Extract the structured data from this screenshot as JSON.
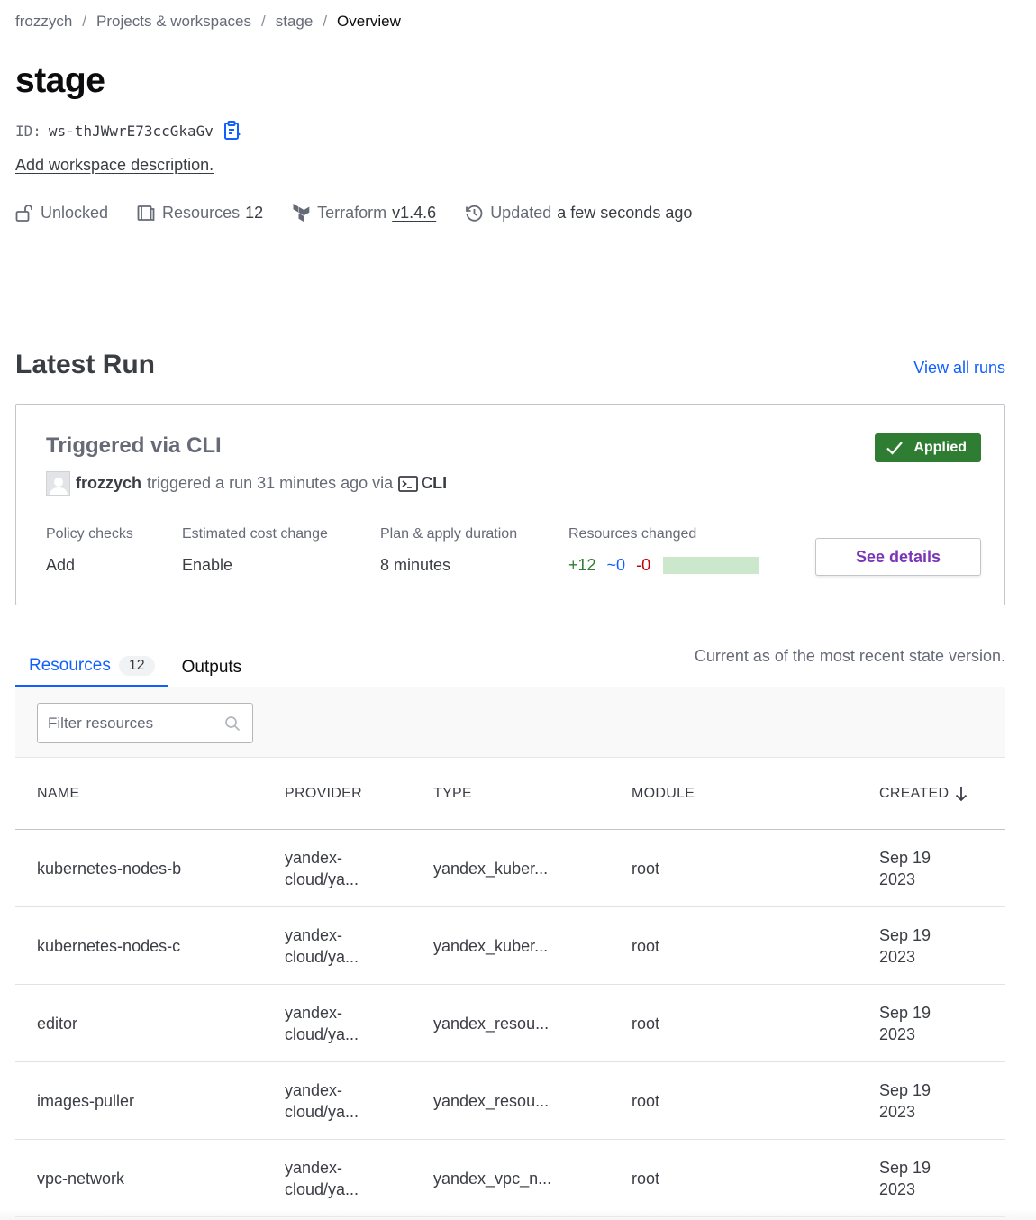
{
  "breadcrumb": {
    "org": "frozzych",
    "projects": "Projects & workspaces",
    "workspace": "stage",
    "current": "Overview",
    "separator": "/"
  },
  "workspace": {
    "name": "stage",
    "id_label": "ID:",
    "id": "ws-thJWwrE73ccGkaGv",
    "add_description": "Add workspace description."
  },
  "meta": {
    "lock_status": "Unlocked",
    "resources_label": "Resources",
    "resources_count": "12",
    "terraform_label": "Terraform",
    "terraform_version": "v1.4.6",
    "updated_label": "Updated",
    "updated_value": "a few seconds ago"
  },
  "latest_run": {
    "section_title": "Latest Run",
    "view_all": "View all runs",
    "title": "Triggered via CLI",
    "status": "Applied",
    "user": "frozzych",
    "triggered_text": "triggered a run 31 minutes ago via",
    "via": "CLI",
    "stats": {
      "policy_label": "Policy checks",
      "policy_value": "Add",
      "cost_label": "Estimated cost change",
      "cost_value": "Enable",
      "duration_label": "Plan & apply duration",
      "duration_value": "8 minutes",
      "changed_label": "Resources changed",
      "added": "+12",
      "changed": "~0",
      "destroyed": "-0"
    },
    "see_details": "See details"
  },
  "tabs": {
    "resources_label": "Resources",
    "resources_count": "12",
    "outputs_label": "Outputs",
    "note": "Current as of the most recent state version."
  },
  "filter": {
    "placeholder": "Filter resources"
  },
  "table": {
    "headers": {
      "name": "NAME",
      "provider": "PROVIDER",
      "type": "TYPE",
      "module": "MODULE",
      "created": "CREATED"
    },
    "rows": [
      {
        "name": "kubernetes-nodes-b",
        "provider_1": "yandex-",
        "provider_2": "cloud/ya...",
        "type": "yandex_kuber...",
        "module": "root",
        "created_1": "Sep 19",
        "created_2": "2023"
      },
      {
        "name": "kubernetes-nodes-c",
        "provider_1": "yandex-",
        "provider_2": "cloud/ya...",
        "type": "yandex_kuber...",
        "module": "root",
        "created_1": "Sep 19",
        "created_2": "2023"
      },
      {
        "name": "editor",
        "provider_1": "yandex-",
        "provider_2": "cloud/ya...",
        "type": "yandex_resou...",
        "module": "root",
        "created_1": "Sep 19",
        "created_2": "2023"
      },
      {
        "name": "images-puller",
        "provider_1": "yandex-",
        "provider_2": "cloud/ya...",
        "type": "yandex_resou...",
        "module": "root",
        "created_1": "Sep 19",
        "created_2": "2023"
      },
      {
        "name": "vpc-network",
        "provider_1": "yandex-",
        "provider_2": "cloud/ya...",
        "type": "yandex_vpc_n...",
        "module": "root",
        "created_1": "Sep 19",
        "created_2": "2023"
      }
    ]
  },
  "colors": {
    "link": "#1060ff",
    "applied": "#2e7d32",
    "added": "#2e7d32",
    "destroyed": "#c00005",
    "details": "#7b36b7"
  },
  "icons": {
    "copy": "clipboard-copy-icon",
    "lock": "unlock-icon",
    "resources": "resources-icon",
    "terraform": "terraform-logo-icon",
    "updated": "history-icon",
    "check": "check-icon",
    "cli": "terminal-icon",
    "search": "search-icon",
    "sort": "arrow-down-icon"
  }
}
